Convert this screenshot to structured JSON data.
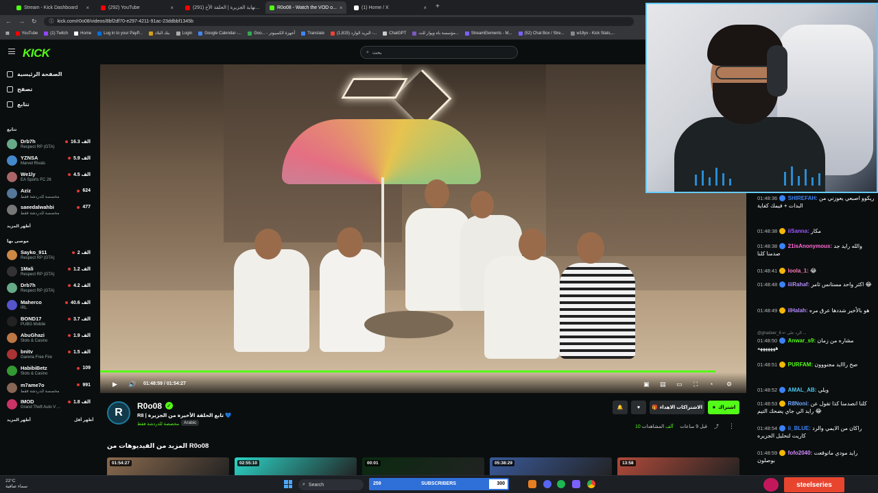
{
  "browser": {
    "tabs": [
      {
        "label": "Stream - Kick Dashboard",
        "color": "#53fc18",
        "active": false
      },
      {
        "label": "(292) YouTube",
        "color": "#ff0000",
        "active": false
      },
      {
        "label": "(291) نهاية الجزيرة | الحلقة الأخ...",
        "color": "#ff0000",
        "active": false
      },
      {
        "label": "R0o08 - Watch the VOD o...",
        "color": "#53fc18",
        "active": true
      },
      {
        "label": "(1) Home / X",
        "color": "#ffffff",
        "active": false
      }
    ],
    "new_tab": "+",
    "url": "kick.com/r0o08/videos/8bf2df70-e297-4211-91ac-23ddbbf1345b",
    "bookmarks": [
      {
        "label": "YouTube",
        "color": "#ff0000"
      },
      {
        "label": "(1) Twitch",
        "color": "#9146ff"
      },
      {
        "label": "Home",
        "color": "#ffffff"
      },
      {
        "label": "Log in to your PayP...",
        "color": "#0070e0"
      },
      {
        "label": "بنك البلاد",
        "color": "#d4a017"
      },
      {
        "label": "Login",
        "color": "#aaaaaa"
      },
      {
        "label": "Google Calendar -...",
        "color": "#4285f4"
      },
      {
        "label": "Goo... - أجهزة الكمبيوتر",
        "color": "#34a853"
      },
      {
        "label": "Translate",
        "color": "#4285f4"
      },
      {
        "label": "البريد الوارد (1,815) -...",
        "color": "#ea4335"
      },
      {
        "label": "ChatGPT",
        "color": "#cccccc"
      },
      {
        "label": "مؤسسة باه ويوار للت...",
        "color": "#7e57c2"
      },
      {
        "label": "StreamElements - M...",
        "color": "#7b61ff"
      },
      {
        "label": "(52) Chat Box / Stre...",
        "color": "#7b61ff"
      },
      {
        "label": "w18yv - Kick Stats,...",
        "color": "#888888"
      }
    ]
  },
  "kick": {
    "logo": "KICK",
    "search_placeholder": "بحث",
    "nav": [
      {
        "label": "الصفحة الرئيسية",
        "icon": "home-icon"
      },
      {
        "label": "تصفح",
        "icon": "browse-icon"
      },
      {
        "label": "تتابع",
        "icon": "heart-icon"
      }
    ],
    "following_header": "تتابع",
    "following": [
      {
        "name": "Drb7h",
        "category": "Respect RP (GTA)",
        "viewers": "16.3 الف",
        "color": "#6a8"
      },
      {
        "name": "YZNSA",
        "category": "Marvel Rivals",
        "viewers": "5.9 الف",
        "color": "#48c"
      },
      {
        "name": "We1ly",
        "category": "EA Sports FC 26",
        "viewers": "4.5 الف",
        "color": "#a66"
      },
      {
        "name": "Aziz",
        "category": "مخصصة للدردشة فقط",
        "viewers": "624",
        "color": "#579"
      },
      {
        "name": "saeedalwahbi",
        "category": "مخصصة للدردشة فقط",
        "viewers": "477",
        "color": "#777"
      }
    ],
    "show_more_1": "أظهر المزيد",
    "recommended_header": "موصى بها",
    "recommended": [
      {
        "name": "Sayko_911",
        "category": "Respect RP (GTA)",
        "viewers": "2 الف",
        "color": "#c84"
      },
      {
        "name": "1Mali",
        "category": "Respect RP (GTA)",
        "viewers": "1.2 الف",
        "color": "#333"
      },
      {
        "name": "Drb7h",
        "category": "Respect RP (GTA)",
        "viewers": "4.2 الف",
        "color": "#6a8"
      },
      {
        "name": "Maherco",
        "category": "IRL",
        "viewers": "40.6 الف",
        "color": "#55c"
      },
      {
        "name": "BOND17",
        "category": "PUBG Mobile",
        "viewers": "3.7 الف",
        "color": "#222"
      },
      {
        "name": "AbuGhazi",
        "category": "Slots & Casino",
        "viewers": "1.9 الف",
        "color": "#b74"
      },
      {
        "name": "bnitv",
        "category": "Garena Free Fire",
        "viewers": "1.5 الف",
        "color": "#a33"
      },
      {
        "name": "HabibiBetz",
        "category": "Slots & Casino",
        "viewers": "109",
        "color": "#393"
      },
      {
        "name": "m7ame7o",
        "category": "مخصصة للدردشة فقط",
        "viewers": "991",
        "color": "#865"
      },
      {
        "name": "IMOD",
        "category": "Grand Theft Auto V ...",
        "viewers": "1.8 الف",
        "color": "#c36"
      }
    ],
    "show_more_2": "أظهر المزيد",
    "show_less": "أظهر أقل"
  },
  "player": {
    "time": "01:48:59 / 01:54:27",
    "progress": 0.952
  },
  "channel": {
    "avatar_letter": "R",
    "name": "R0o08",
    "title": "R8 | تابع الحلقة الأخيرة من الجزيرة 💙",
    "category": "مخصصة للدردشة فقط",
    "language": "Arabic",
    "follow_label": "اشتراك",
    "gift_label": "الاشتراكات الاهداء",
    "stats": {
      "views": "10 آلف",
      "views_label": "المشاهدات",
      "ago": "قبل 9 ساعات"
    }
  },
  "more_videos": {
    "heading": "المزيد من الفيديوهات من R0o08",
    "items": [
      {
        "duration": "01:54:27",
        "color": "#8a6a4e"
      },
      {
        "duration": "02:55:10",
        "color": "#2bd3c6"
      },
      {
        "duration": "00:01",
        "color": "#0a2a10"
      },
      {
        "duration": "05:38:29",
        "color": "#3a5a9a"
      },
      {
        "duration": "13:58",
        "color": "#b04a3a"
      }
    ]
  },
  "chat": {
    "messages": [
      {
        "time": "01:48:36",
        "user": "SHIREFAH:",
        "color": "#3b82f6",
        "text": "ريكوو اصبعي يعوزني من البدات + فيمك كفاية"
      },
      {
        "time": "01:48:38",
        "user": "iiSanna:",
        "color": "#9b59ff",
        "text": "مكار"
      },
      {
        "time": "01:48:38",
        "user": "21isAnonymous:",
        "color": "#ff6ad5",
        "text": "والله رايد جد صدمنا كلنا"
      },
      {
        "time": "01:48:41",
        "user": "loola_1:",
        "color": "#ff7ab8",
        "text": "😂"
      },
      {
        "time": "01:48:48",
        "user": "iiiRahaf:",
        "color": "#b38bff",
        "text": "اكثر واحد مستانس ثامر 😂"
      },
      {
        "time": "01:48:49",
        "user": "ilHalah:",
        "color": "#b38bff",
        "text": "هو بالأخير شددها عرق مره"
      },
      {
        "time": "01:48:50",
        "user": "Anwar_s9:",
        "color": "#53fc18",
        "text": "مشاره من زمان هههههههه"
      },
      {
        "time": "01:48:51",
        "user": "PURFAM:",
        "color": "#53fc18",
        "text": "صح رااايد مجنووون"
      },
      {
        "time": "01:48:52",
        "user": "AMAL_AB:",
        "color": "#4cc9f0",
        "text": "ويلي"
      },
      {
        "time": "01:48:53",
        "user": "R8Noni:",
        "color": "#6fa8ff",
        "text": "كلنا انصدمنا كذا تقول عن رايد الي جاي يضحك التيم 😂"
      },
      {
        "time": "01:48:54",
        "user": "ii_BLUE:",
        "color": "#3b82f6",
        "text": "راكان من الايمي والرد كاريت لتحليل الجزيره"
      },
      {
        "time": "01:48:59",
        "user": "fofo2040:",
        "color": "#d38cff",
        "text": "رايد مودي ماتوقعت بوصلون"
      }
    ],
    "system_note": "@ghadeer_6 ↩ الرد على ..."
  },
  "taskbar": {
    "temp": "22°C",
    "weather": "سماء صافية",
    "search": "Search",
    "subs_count": "259",
    "subs_label": "SUBSCRIBERS",
    "subs_goal": "300",
    "subs_fraction": 0.863,
    "brand": "steelseries"
  }
}
